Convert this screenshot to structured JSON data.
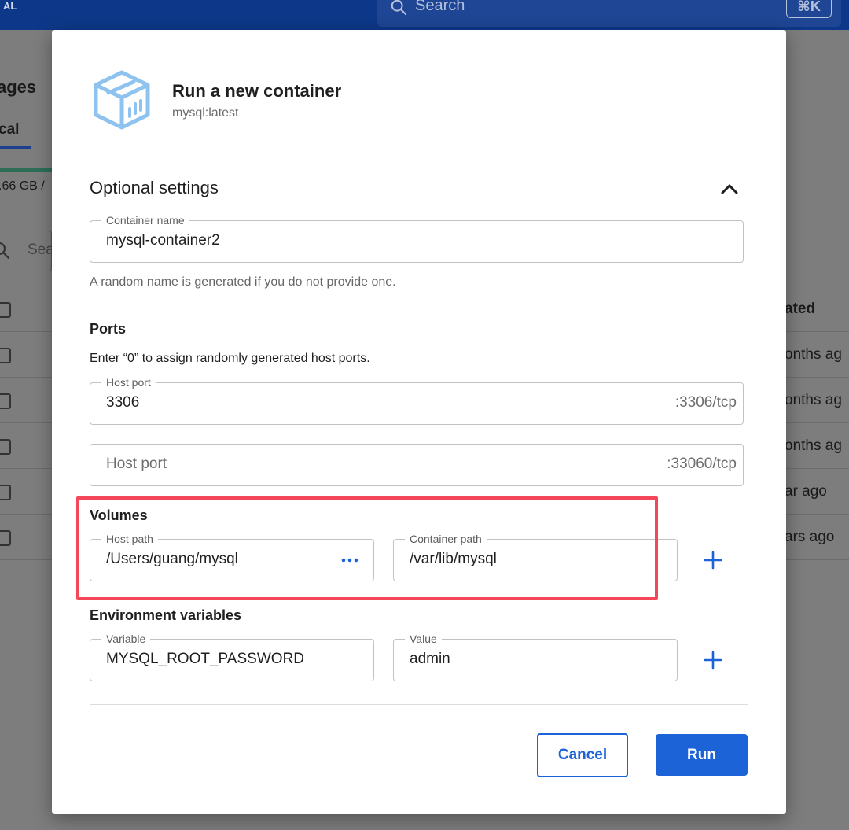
{
  "background": {
    "topbar": {
      "badge": "AL",
      "search_placeholder": "Search",
      "shortcut": "⌘K"
    },
    "page_title": "ages",
    "tab_label": "cal",
    "storage_text": ".66 GB /",
    "search_placeholder": "Sea",
    "table": {
      "header_col": "ated",
      "rows": [
        "onths ag",
        "onths ag",
        "onths ag",
        "ar ago",
        "ars ago"
      ]
    }
  },
  "modal": {
    "title": "Run a new container",
    "subtitle": "mysql:latest",
    "optional_settings": {
      "title": "Optional settings",
      "container_name": {
        "label": "Container name",
        "value": "mysql-container2"
      },
      "container_name_helper": "A random name is generated if you do not provide one.",
      "ports": {
        "title": "Ports",
        "hint": "Enter “0” to assign randomly generated host ports.",
        "items": [
          {
            "label": "Host port",
            "value": "3306",
            "container_port": ":3306/tcp"
          },
          {
            "placeholder": "Host port",
            "container_port": ":33060/tcp"
          }
        ]
      },
      "volumes": {
        "title": "Volumes",
        "host_path_label": "Host path",
        "host_path_value": "/Users/guang/mysql",
        "container_path_label": "Container path",
        "container_path_value": "/var/lib/mysql"
      },
      "env": {
        "title": "Environment variables",
        "variable_label": "Variable",
        "variable_value": "MYSQL_ROOT_PASSWORD",
        "value_label": "Value",
        "value_value": "admin"
      }
    },
    "actions": {
      "cancel": "Cancel",
      "run": "Run"
    }
  },
  "colors": {
    "primary": "#1d63d8",
    "highlight": "#f4485a",
    "topbar": "#0d3889",
    "icon": "#8fc3ef"
  }
}
